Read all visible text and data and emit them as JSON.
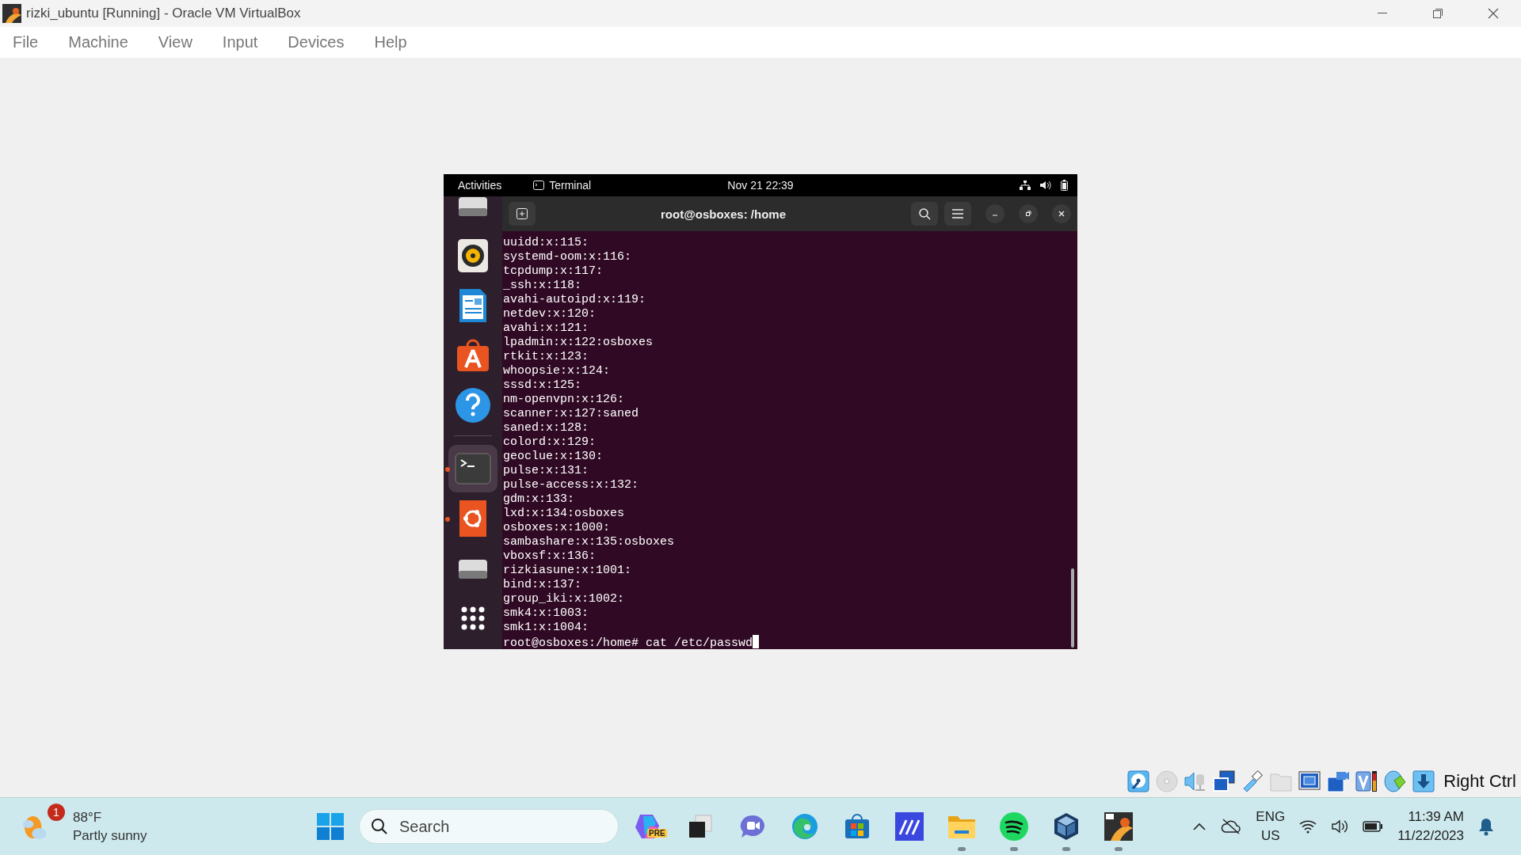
{
  "window": {
    "title": "rizki_ubuntu [Running] - Oracle VM VirtualBox"
  },
  "menu": [
    "File",
    "Machine",
    "View",
    "Input",
    "Devices",
    "Help"
  ],
  "guest": {
    "top_bar": {
      "activities": "Activities",
      "app": "Terminal",
      "clock": "Nov 21  22:39"
    },
    "dock": [
      {
        "kind": "drive",
        "selected": false,
        "running": false
      },
      {
        "kind": "speaker",
        "selected": false,
        "running": false
      },
      {
        "kind": "document",
        "selected": false,
        "running": false
      },
      {
        "kind": "store",
        "selected": false,
        "running": false
      },
      {
        "kind": "help",
        "selected": false,
        "running": false
      },
      {
        "kind": "separator"
      },
      {
        "kind": "terminal",
        "selected": true,
        "running": true
      },
      {
        "kind": "ubuntu",
        "selected": false,
        "running": true
      },
      {
        "kind": "drive",
        "selected": false,
        "running": false
      },
      {
        "kind": "grid",
        "selected": false,
        "running": false
      }
    ],
    "terminal": {
      "title": "root@osboxes: /home",
      "lines": [
        "uuidd:x:115:",
        "systemd-oom:x:116:",
        "tcpdump:x:117:",
        "_ssh:x:118:",
        "avahi-autoipd:x:119:",
        "netdev:x:120:",
        "avahi:x:121:",
        "lpadmin:x:122:osboxes",
        "rtkit:x:123:",
        "whoopsie:x:124:",
        "sssd:x:125:",
        "nm-openvpn:x:126:",
        "scanner:x:127:saned",
        "saned:x:128:",
        "colord:x:129:",
        "geoclue:x:130:",
        "pulse:x:131:",
        "pulse-access:x:132:",
        "gdm:x:133:",
        "lxd:x:134:osboxes",
        "osboxes:x:1000:",
        "sambashare:x:135:osboxes",
        "vboxsf:x:136:",
        "rizkiasune:x:1001:",
        "bind:x:137:",
        "group_iki:x:1002:",
        "smk4:x:1003:",
        "smk1:x:1004:"
      ],
      "prompt": "root@osboxes:/home# cat /etc/passwd"
    }
  },
  "status_bar": {
    "hotkey": "Right Ctrl"
  },
  "taskbar": {
    "weather": {
      "badge": "1",
      "temperature": "88°F",
      "condition": "Partly sunny"
    },
    "search": {
      "placeholder": "Search"
    },
    "apps": [
      {
        "kind": "copilot",
        "badge": "PRE",
        "running": false
      },
      {
        "kind": "taskview",
        "running": false
      },
      {
        "kind": "chat",
        "running": false
      },
      {
        "kind": "edge",
        "running": false
      },
      {
        "kind": "store",
        "running": false
      },
      {
        "kind": "ma",
        "running": false
      },
      {
        "kind": "folder",
        "running": true
      },
      {
        "kind": "spotify",
        "running": true
      },
      {
        "kind": "cube",
        "running": true
      },
      {
        "kind": "vbox",
        "running": true
      }
    ],
    "tray": {
      "language": "ENG",
      "region": "US",
      "time": "11:39 AM",
      "date": "11/22/2023"
    }
  }
}
